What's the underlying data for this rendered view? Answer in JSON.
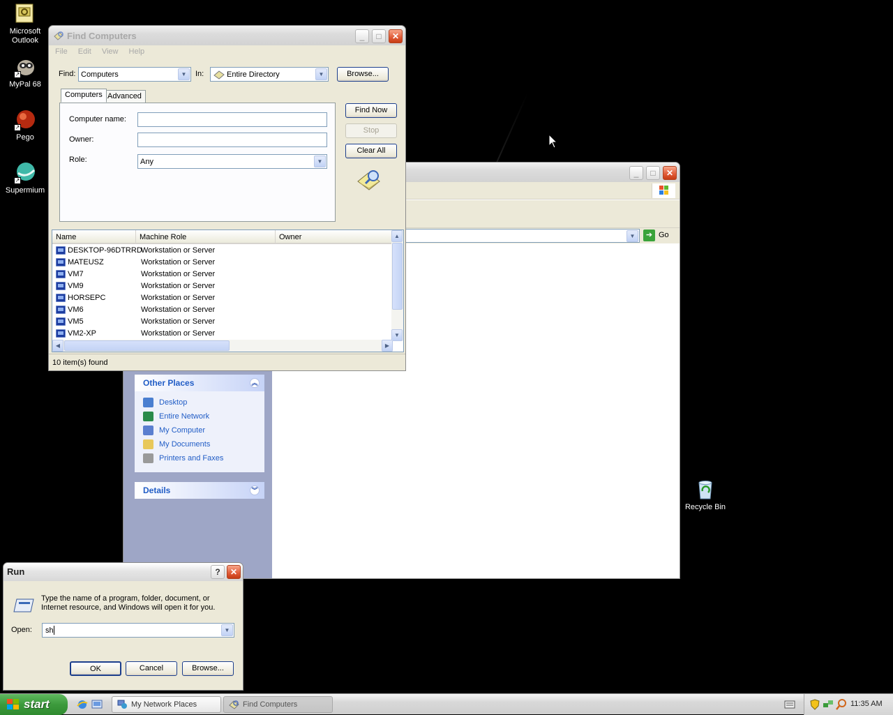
{
  "desktop": {
    "icons": [
      {
        "label": "Microsoft\nOutlook",
        "icon": "outlook-icon"
      },
      {
        "label": "MyPal 68",
        "icon": "mypal-icon"
      },
      {
        "label": "Pego",
        "icon": "pego-icon"
      },
      {
        "label": "Supermium",
        "icon": "supermium-icon"
      },
      {
        "label": "Recycle Bin",
        "icon": "recycle-bin-icon"
      }
    ]
  },
  "find_computers": {
    "title": "Find Computers",
    "menu": [
      "File",
      "Edit",
      "View",
      "Help"
    ],
    "find_label": "Find:",
    "find_value": "Computers",
    "in_label": "In:",
    "in_value": "Entire Directory",
    "browse_label": "Browse...",
    "tabs": [
      "Computers",
      "Advanced"
    ],
    "active_tab": "Computers",
    "computer_name_label": "Computer name:",
    "computer_name_value": "",
    "owner_label": "Owner:",
    "owner_value": "",
    "role_label": "Role:",
    "role_value": "Any",
    "find_now_label": "Find Now",
    "stop_label": "Stop",
    "clear_all_label": "Clear All",
    "columns": [
      "Name",
      "Machine Role",
      "Owner"
    ],
    "results": [
      {
        "name": "DESKTOP-96DTRRD",
        "role": "Workstation or Server",
        "owner": ""
      },
      {
        "name": "MATEUSZ",
        "role": "Workstation or Server",
        "owner": ""
      },
      {
        "name": "VM7",
        "role": "Workstation or Server",
        "owner": ""
      },
      {
        "name": "VM9",
        "role": "Workstation or Server",
        "owner": ""
      },
      {
        "name": "HORSEPC",
        "role": "Workstation or Server",
        "owner": ""
      },
      {
        "name": "VM6",
        "role": "Workstation or Server",
        "owner": ""
      },
      {
        "name": "VM5",
        "role": "Workstation or Server",
        "owner": ""
      },
      {
        "name": "VM2-XP",
        "role": "Workstation or Server",
        "owner": ""
      }
    ],
    "status": "10 item(s) found"
  },
  "network_places": {
    "go_label": "Go",
    "other_places_title": "Other Places",
    "other_places": [
      {
        "label": "Desktop",
        "icon": "desktop-icon",
        "color": "#4a7fd0"
      },
      {
        "label": "Entire Network",
        "icon": "globe-icon",
        "color": "#2a8a4a"
      },
      {
        "label": "My Computer",
        "icon": "computer-icon",
        "color": "#5b7fcf"
      },
      {
        "label": "My Documents",
        "icon": "folder-icon",
        "color": "#e8c85a"
      },
      {
        "label": "Printers and Faxes",
        "icon": "printer-icon",
        "color": "#9a9a9a"
      }
    ],
    "details_title": "Details"
  },
  "run_dialog": {
    "title": "Run",
    "help_label": "?",
    "description": "Type the name of a program, folder, document, or Internet resource, and Windows will open it for you.",
    "open_label": "Open:",
    "open_value": "sh",
    "ok_label": "OK",
    "cancel_label": "Cancel",
    "browse_label": "Browse..."
  },
  "taskbar": {
    "start_label": "start",
    "tasks": [
      {
        "label": "My Network Places",
        "icon": "network-places-icon",
        "active": false
      },
      {
        "label": "Find Computers",
        "icon": "find-computers-icon",
        "active": true
      }
    ],
    "clock": "11:35 AM"
  },
  "colors": {
    "xp_blue_link": "#215dc6",
    "task_pane_bg": "#9ea6c6",
    "start_green": "#3c9a3c",
    "close_red": "#e05a36"
  }
}
